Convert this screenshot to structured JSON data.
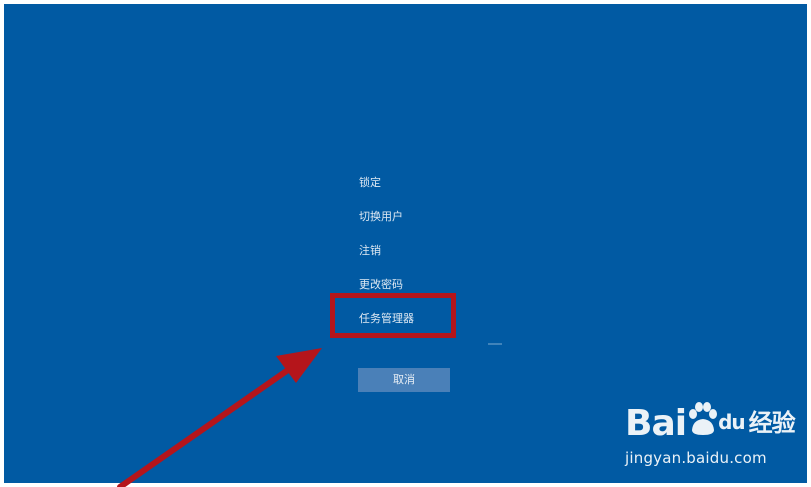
{
  "menu": {
    "items": [
      {
        "label": "锁定"
      },
      {
        "label": "切换用户"
      },
      {
        "label": "注销"
      },
      {
        "label": "更改密码"
      },
      {
        "label": "任务管理器"
      }
    ],
    "highlighted_item": "任务管理器"
  },
  "cancel_button": {
    "label": "取消"
  },
  "watermark": {
    "logo_text": "Bai",
    "logo_text_2": "du",
    "logo_text_3": "经验",
    "url": "jingyan.baidu.com"
  },
  "colors": {
    "background": "#015aa3",
    "annotation": "#b5151b",
    "button": "#4a80b8"
  },
  "icons": [
    "paw-icon",
    "red-arrow"
  ]
}
